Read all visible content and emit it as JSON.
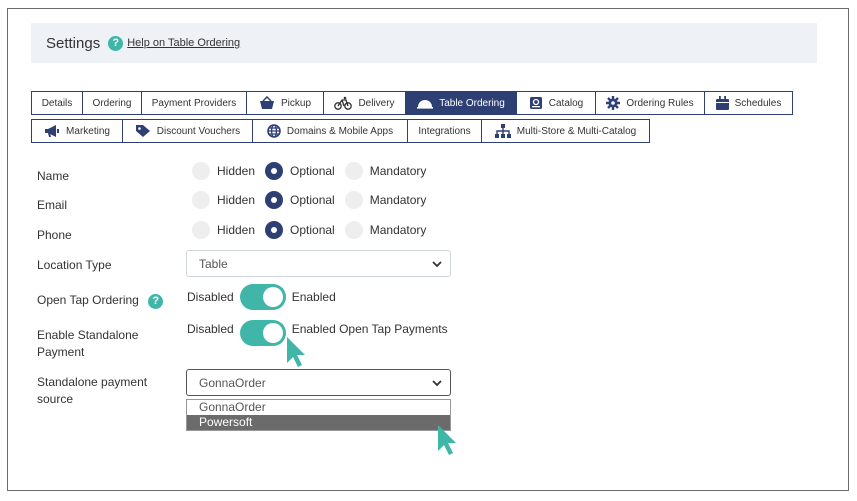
{
  "header": {
    "title": "Settings",
    "help_link": "Help on Table Ordering"
  },
  "tabs_row1": [
    {
      "label": "Details",
      "icon": ""
    },
    {
      "label": "Ordering",
      "icon": ""
    },
    {
      "label": "Payment Providers",
      "icon": ""
    },
    {
      "label": "Pickup",
      "icon": "basket-icon"
    },
    {
      "label": "Delivery",
      "icon": "bicycle-icon"
    },
    {
      "label": "Table Ordering",
      "icon": "cloche-icon",
      "active": true
    },
    {
      "label": "Catalog",
      "icon": "catalog-icon"
    },
    {
      "label": "Ordering Rules",
      "icon": "gear-icon"
    },
    {
      "label": "Schedules",
      "icon": "calendar-icon"
    }
  ],
  "tabs_row2": [
    {
      "label": "Marketing",
      "icon": "megaphone-icon"
    },
    {
      "label": "Discount Vouchers",
      "icon": "tag-icon"
    },
    {
      "label": "Domains & Mobile Apps",
      "icon": "globe-icon"
    },
    {
      "label": "Integrations",
      "icon": ""
    },
    {
      "label": "Multi-Store & Multi-Catalog",
      "icon": "sitemap-icon"
    }
  ],
  "form": {
    "name": {
      "label": "Name",
      "selected": "Optional"
    },
    "email": {
      "label": "Email",
      "selected": "Optional"
    },
    "phone": {
      "label": "Phone",
      "selected": "Optional"
    },
    "visibility_options": [
      "Hidden",
      "Optional",
      "Mandatory"
    ],
    "location_type": {
      "label": "Location Type",
      "value": "Table"
    },
    "open_tap": {
      "label": "Open Tap Ordering",
      "off_label": "Disabled",
      "on_label": "Enabled",
      "enabled": true
    },
    "standalone_payment": {
      "label": "Enable Standalone Payment",
      "off_label": "Disabled",
      "on_label": "Enabled Open Tap Payments",
      "enabled": true
    },
    "payment_source": {
      "label": "Standalone payment source",
      "value": "GonnaOrder",
      "options": [
        "GonnaOrder",
        "Powersoft"
      ],
      "highlighted": "Powersoft"
    }
  },
  "colors": {
    "navy": "#2e3f74",
    "teal": "#3fb6a8",
    "cursor": "#3fb6a8"
  }
}
